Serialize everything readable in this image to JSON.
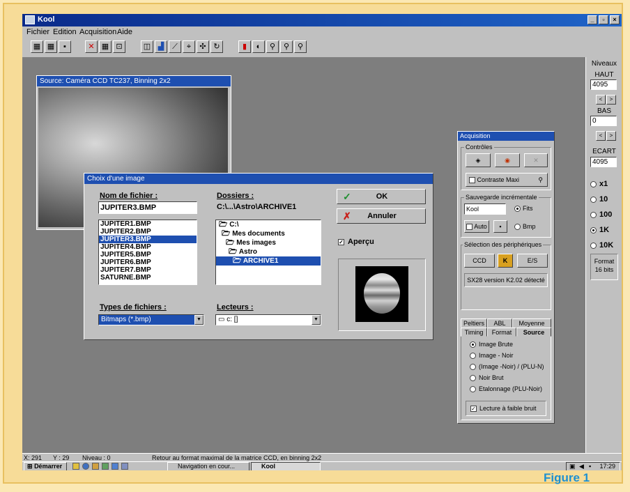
{
  "app": {
    "title": "Kool"
  },
  "menu": [
    "Fichier",
    "Edition",
    "Acquisition",
    "Aide"
  ],
  "source_window": {
    "title": "Source: Caméra CCD TC237, Binning 2x2"
  },
  "dialog": {
    "title": "Choix d'une image",
    "filename_label": "Nom de fichier :",
    "filename_value": "JUPITER3.BMP",
    "files": [
      "JUPITER1.BMP",
      "JUPITER2.BMP",
      "JUPITER3.BMP",
      "JUPITER4.BMP",
      "JUPITER5.BMP",
      "JUPITER6.BMP",
      "JUPITER7.BMP",
      "SATURNE.BMP"
    ],
    "selected_file": "JUPITER3.BMP",
    "folders_label": "Dossiers :",
    "folder_path": "C:\\...\\Astro\\ARCHIVE1",
    "folders": [
      "C:\\",
      "Mes documents",
      "Mes images",
      "Astro",
      "ARCHIVE1"
    ],
    "filetypes_label": "Types de fichiers :",
    "filetype_value": "Bitmaps (*.bmp)",
    "drives_label": "Lecteurs :",
    "drive_value": "c: []",
    "ok_label": "OK",
    "cancel_label": "Annuler",
    "preview_label": "Aperçu"
  },
  "levels": {
    "title": "Niveaux",
    "haut_label": "HAUT",
    "haut_value": "4095",
    "bas_label": "BAS",
    "bas_value": "0",
    "ecart_label": "ECART",
    "ecart_value": "4095",
    "zoom_options": [
      "x1",
      "10",
      "100",
      "1K",
      "10K"
    ],
    "zoom_selected": "1K",
    "format_label": "Format",
    "format_value": "16 bits"
  },
  "acquisition": {
    "title": "Acquisition",
    "controls_label": "Contrôles",
    "contrast_label": "Contraste Maxi",
    "incremental_label": "Sauvegarde incrémentale",
    "incremental_value": "Kool",
    "fits_label": "Fits",
    "auto_label": "Auto",
    "bmp_label": "Bmp",
    "devices_label": "Sélection des périphériques",
    "ccd_label": "CCD",
    "es_label": "E/S",
    "detected_text": "SX28 version K2.02 détecté",
    "tabs_row1": [
      "Peltiers",
      "ABL",
      "Moyenne"
    ],
    "tabs_row2": [
      "Timing",
      "Format",
      "Source"
    ],
    "source_options": [
      "Image Brute",
      "Image - Noir",
      "(Image -Noir) / (PLU-N)",
      "Noir Brut",
      "Etalonnage (PLU-Noir)"
    ],
    "source_selected": "Image Brute",
    "low_noise_label": "Lecture à faible bruit"
  },
  "status": {
    "x": "X: 291",
    "y": "Y : 29",
    "niveau": "Niveau : 0",
    "message": "Retour au format maximal de la matrice CCD, en binning 2x2"
  },
  "taskbar": {
    "start_label": "Démarrer",
    "items": [
      "Navigation en cour...",
      "Kool"
    ],
    "time": "17:29"
  },
  "caption": "Figure 1"
}
